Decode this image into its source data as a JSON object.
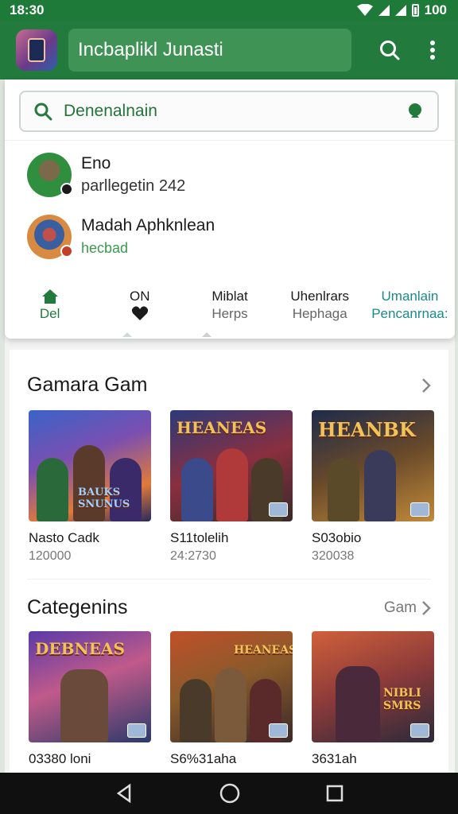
{
  "status_bar": {
    "time": "18:30",
    "battery": "100"
  },
  "app_bar": {
    "title": "Incbaplikl Junasti",
    "logo_icon": "app-logo-icon",
    "search_icon": "search-icon",
    "menu_icon": "more-vert-icon"
  },
  "search": {
    "value": "Denenalnain",
    "icon": "search-icon",
    "mic_icon": "voice-icon"
  },
  "suggestions": [
    {
      "title": "Eno",
      "subtitle": "parllegetin 242"
    },
    {
      "title": "Madah Aphknlean",
      "subtitle": "hecbad"
    }
  ],
  "tabs": [
    {
      "line1": "",
      "line2": "Del",
      "icon": "home-icon"
    },
    {
      "line1": "ON",
      "line2": "",
      "icon": "heart-icon"
    },
    {
      "line1": "Miblat",
      "line2": "Herps"
    },
    {
      "line1": "Uhenlrars",
      "line2": "Hephaga"
    },
    {
      "line1": "Umanlain",
      "line2": "Pencanrnaa:"
    }
  ],
  "section1": {
    "title": "Gamara Gam",
    "items": [
      {
        "name": "Nasto Cadk",
        "sub": "120000",
        "art_text": "BAUKS SNUNUS"
      },
      {
        "name": "S11tolelih",
        "sub": "24:2730",
        "art_text": "HEANEAS"
      },
      {
        "name": "S03obio",
        "sub": "320038",
        "art_text": "HEANBK"
      }
    ]
  },
  "section2": {
    "title": "Categenins",
    "more": "Gam",
    "items": [
      {
        "name": "03380 loni",
        "art_text": "DEBNEAS"
      },
      {
        "name": "S6%31aha",
        "art_text": "HEANEAS"
      },
      {
        "name": "3631ah",
        "art_text": "NIBLI SMRS"
      }
    ]
  },
  "colors": {
    "primary": "#237a3d",
    "accent": "#3a9a4e",
    "teal": "#1b8a8a"
  }
}
